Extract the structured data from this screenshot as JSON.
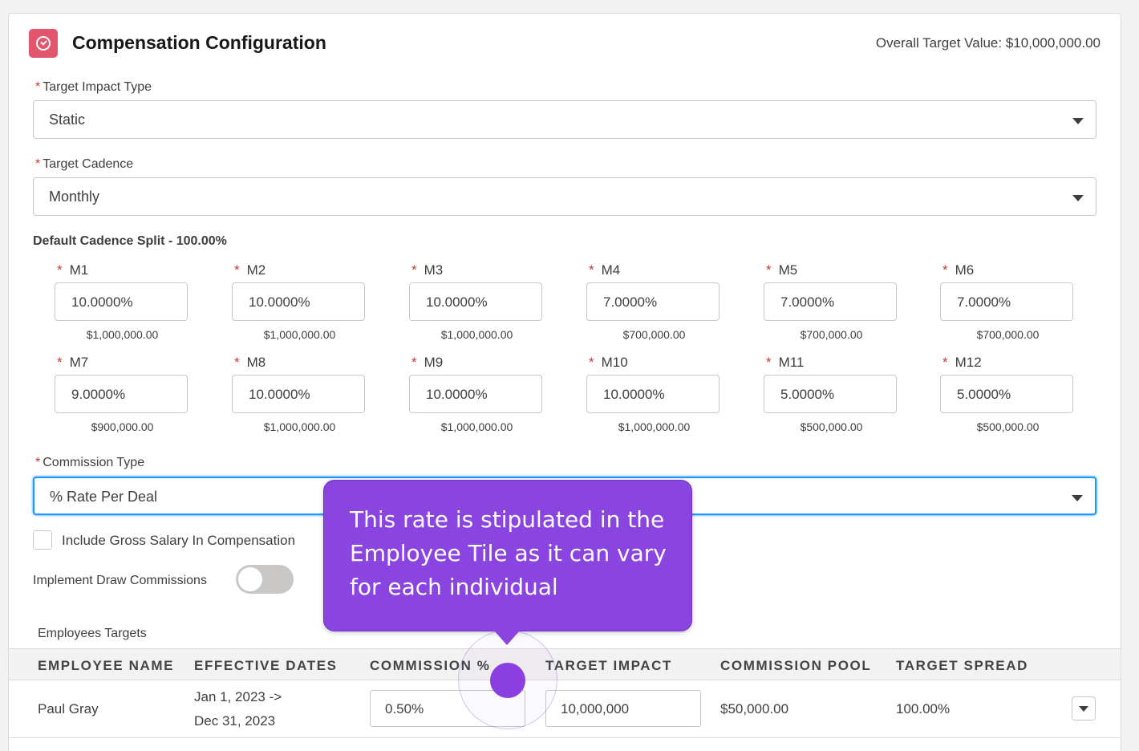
{
  "header": {
    "title": "Compensation Configuration",
    "overall_target": "Overall Target Value: $10,000,000.00",
    "icon": "gauge-icon"
  },
  "required_marker": "*",
  "fields": {
    "target_impact_type": {
      "label": "Target Impact Type",
      "value": "Static"
    },
    "target_cadence": {
      "label": "Target Cadence",
      "value": "Monthly"
    },
    "commission_type": {
      "label": "Commission Type",
      "value": "% Rate Per Deal"
    }
  },
  "split": {
    "title": "Default Cadence Split - 100.00%",
    "months": [
      {
        "label": "M1",
        "pct": "10.0000%",
        "amount": "$1,000,000.00"
      },
      {
        "label": "M2",
        "pct": "10.0000%",
        "amount": "$1,000,000.00"
      },
      {
        "label": "M3",
        "pct": "10.0000%",
        "amount": "$1,000,000.00"
      },
      {
        "label": "M4",
        "pct": "7.0000%",
        "amount": "$700,000.00"
      },
      {
        "label": "M5",
        "pct": "7.0000%",
        "amount": "$700,000.00"
      },
      {
        "label": "M6",
        "pct": "7.0000%",
        "amount": "$700,000.00"
      },
      {
        "label": "M7",
        "pct": "9.0000%",
        "amount": "$900,000.00"
      },
      {
        "label": "M8",
        "pct": "10.0000%",
        "amount": "$1,000,000.00"
      },
      {
        "label": "M9",
        "pct": "10.0000%",
        "amount": "$1,000,000.00"
      },
      {
        "label": "M10",
        "pct": "10.0000%",
        "amount": "$1,000,000.00"
      },
      {
        "label": "M11",
        "pct": "5.0000%",
        "amount": "$500,000.00"
      },
      {
        "label": "M12",
        "pct": "5.0000%",
        "amount": "$500,000.00"
      }
    ]
  },
  "options": {
    "include_gross_salary": {
      "label": "Include Gross Salary In Compensation",
      "checked": false
    },
    "implement_draw": {
      "label": "Implement Draw Commissions",
      "on": false
    }
  },
  "employees": {
    "title": "Employees Targets",
    "columns": [
      "EMPLOYEE NAME",
      "EFFECTIVE DATES",
      "COMMISSION %",
      "TARGET IMPACT",
      "COMMISSION POOL",
      "TARGET SPREAD"
    ],
    "rows": [
      {
        "name": "Paul Gray",
        "date_start": "Jan 1, 2023 ->",
        "date_end": "Dec 31, 2023",
        "commission": "0.50%",
        "target_impact": "10,000,000",
        "commission_pool": "$50,000.00",
        "target_spread": "100.00%"
      }
    ]
  },
  "tooltip": {
    "text": "This rate is stipulated in the Employee Tile as it can vary for each individual"
  },
  "colors": {
    "accent": "#8a44e0",
    "icon_bg": "#e3556c",
    "focus": "#1b96ff",
    "required": "#c23934"
  }
}
